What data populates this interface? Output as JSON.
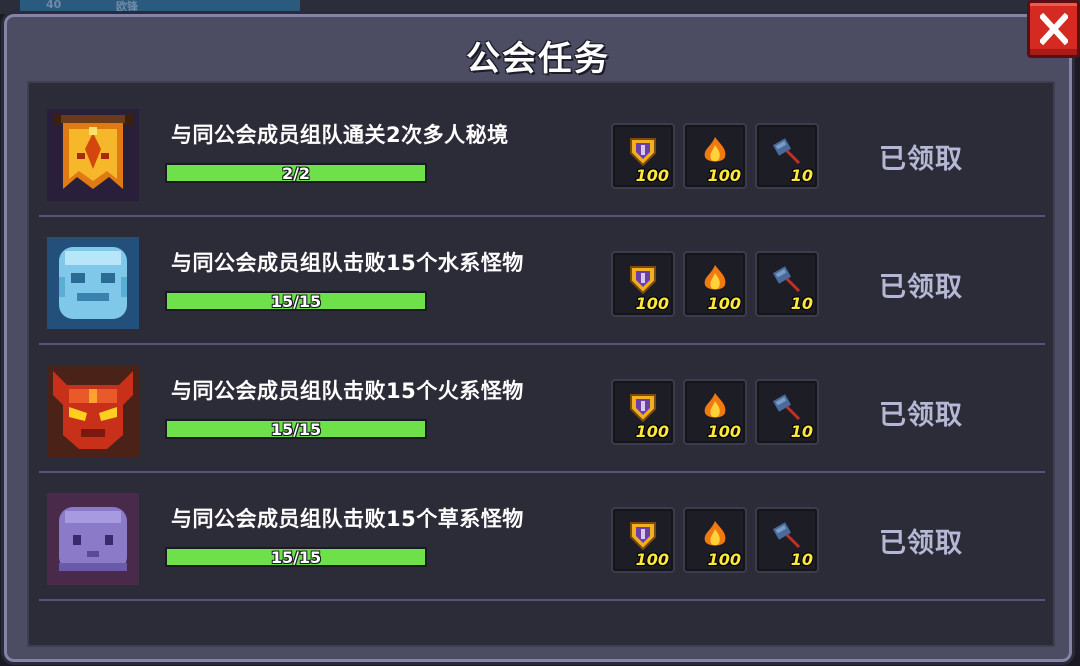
{
  "background": {
    "top_strip_left": "40",
    "top_strip_text": "欧锋"
  },
  "dialog": {
    "title": "公会任务",
    "close_icon": "close-icon"
  },
  "tasks": [
    {
      "icon": "guild-banner-icon",
      "text": "与同公会成员组队通关2次多人秘境",
      "progress_text": "2/2",
      "progress_fraction": 1.0,
      "rewards": [
        {
          "icon": "guild-shield-icon",
          "amount": "100"
        },
        {
          "icon": "flame-icon",
          "amount": "100"
        },
        {
          "icon": "hammer-icon",
          "amount": "10"
        }
      ],
      "status": "已领取"
    },
    {
      "icon": "water-monster-icon",
      "text": "与同公会成员组队击败15个水系怪物",
      "progress_text": "15/15",
      "progress_fraction": 1.0,
      "rewards": [
        {
          "icon": "guild-shield-icon",
          "amount": "100"
        },
        {
          "icon": "flame-icon",
          "amount": "100"
        },
        {
          "icon": "hammer-icon",
          "amount": "10"
        }
      ],
      "status": "已领取"
    },
    {
      "icon": "fire-monster-icon",
      "text": "与同公会成员组队击败15个火系怪物",
      "progress_text": "15/15",
      "progress_fraction": 1.0,
      "rewards": [
        {
          "icon": "guild-shield-icon",
          "amount": "100"
        },
        {
          "icon": "flame-icon",
          "amount": "100"
        },
        {
          "icon": "hammer-icon",
          "amount": "10"
        }
      ],
      "status": "已领取"
    },
    {
      "icon": "grass-monster-icon",
      "text": "与同公会成员组队击败15个草系怪物",
      "progress_text": "15/15",
      "progress_fraction": 1.0,
      "rewards": [
        {
          "icon": "guild-shield-icon",
          "amount": "100"
        },
        {
          "icon": "flame-icon",
          "amount": "100"
        },
        {
          "icon": "hammer-icon",
          "amount": "10"
        }
      ],
      "status": "已领取"
    }
  ],
  "colors": {
    "progress_fill": "#6ee04a",
    "reward_amount": "#ffe83a",
    "claimed_text": "#b4b8d4",
    "close_button": "#d42a22"
  }
}
